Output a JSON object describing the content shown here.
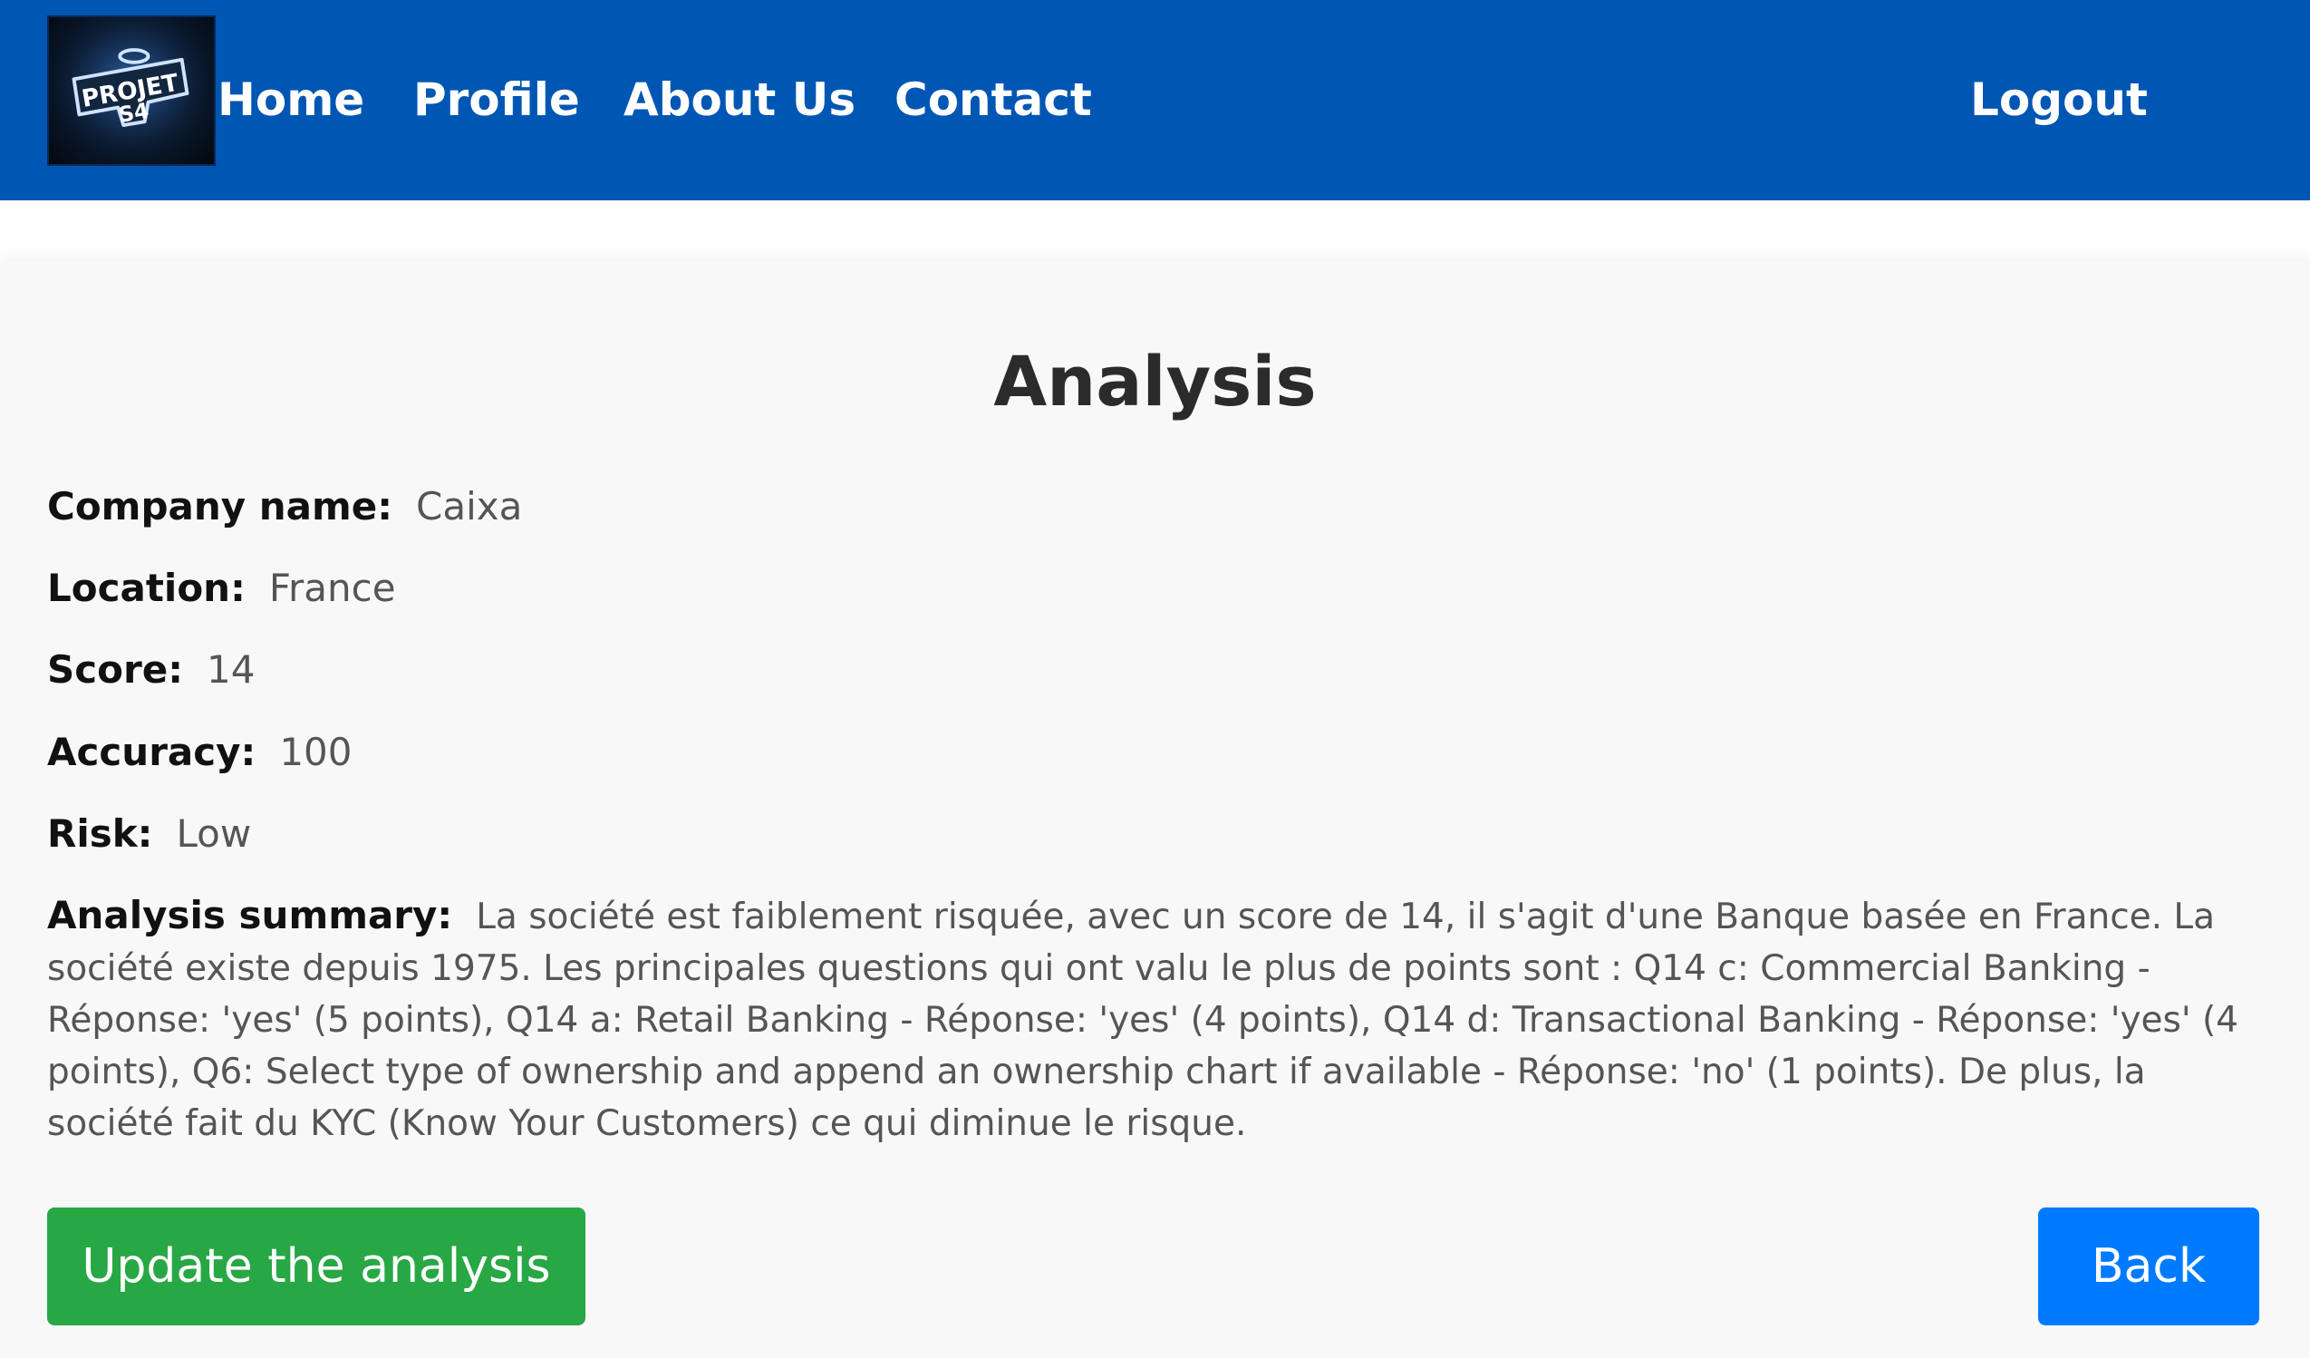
{
  "logo": {
    "text_line1": "PROJET",
    "text_line2": "S4"
  },
  "nav": {
    "home": "Home",
    "profile": "Profile",
    "about": "About Us",
    "contact": "Contact",
    "logout": "Logout"
  },
  "page": {
    "title": "Analysis"
  },
  "analysis": {
    "company_label": "Company name:",
    "company_value": "Caixa",
    "location_label": "Location:",
    "location_value": "France",
    "score_label": "Score:",
    "score_value": "14",
    "accuracy_label": "Accuracy:",
    "accuracy_value": "100",
    "risk_label": "Risk:",
    "risk_value": "Low",
    "summary_label": "Analysis summary:",
    "summary_value": "La société est faiblement risquée, avec un score de 14, il s'agit d'une Banque basée en France. La société existe depuis 1975. Les principales questions qui ont valu le plus de points sont : Q14 c: Commercial Banking - Réponse: 'yes' (5 points), Q14 a: Retail Banking - Réponse: 'yes' (4 points), Q14 d: Transactional Banking - Réponse: 'yes' (4 points), Q6: Select type of ownership and append an ownership chart if available - Réponse: 'no' (1 points). De plus, la société fait du KYC (Know Your Customers) ce qui diminue le risque."
  },
  "buttons": {
    "update": "Update the analysis",
    "back": "Back"
  },
  "colors": {
    "navbar": "#0056b3",
    "update_button": "#28a745",
    "back_button": "#007bff",
    "background": "#f8f8f8"
  }
}
